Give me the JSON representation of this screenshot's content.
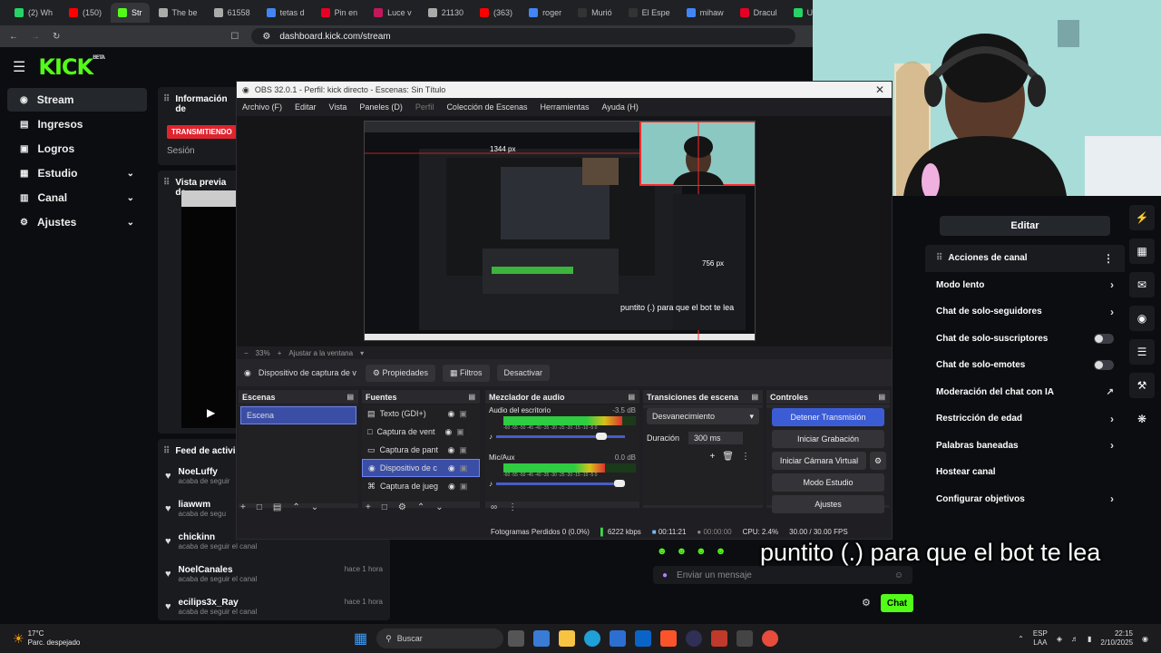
{
  "browser": {
    "tabs": [
      {
        "label": "(2) Wh",
        "color": "#25d366"
      },
      {
        "label": "(150)",
        "color": "#ff0000"
      },
      {
        "label": "Str",
        "color": "#53fc18",
        "active": true
      },
      {
        "label": "The be",
        "color": "#aaaaaa"
      },
      {
        "label": "61558",
        "color": "#aaaaaa"
      },
      {
        "label": "tetas d",
        "color": "#4285f4"
      },
      {
        "label": "Pin en",
        "color": "#e60023"
      },
      {
        "label": "Luce v",
        "color": "#c2185b"
      },
      {
        "label": "21130",
        "color": "#aaaaaa"
      },
      {
        "label": "(363)",
        "color": "#ff0000"
      },
      {
        "label": "roger",
        "color": "#4285f4"
      },
      {
        "label": "Murió",
        "color": "#333333"
      },
      {
        "label": "El Espe",
        "color": "#333333"
      },
      {
        "label": "mihaw",
        "color": "#4285f4"
      },
      {
        "label": "Dracul",
        "color": "#e60023"
      },
      {
        "label": "U",
        "color": "#25d366"
      }
    ],
    "url": "dashboard.kick.com/stream"
  },
  "kick": {
    "logo": "KICK",
    "logo_tag": "BETA",
    "nav": [
      {
        "label": "Stream",
        "icon": "broadcast-icon",
        "active": true
      },
      {
        "label": "Ingresos",
        "icon": "money-icon"
      },
      {
        "label": "Logros",
        "icon": "trophy-icon"
      },
      {
        "label": "Estudio",
        "icon": "studio-icon",
        "expandable": true
      },
      {
        "label": "Canal",
        "icon": "channel-icon",
        "expandable": true
      },
      {
        "label": "Ajustes",
        "icon": "gear-icon",
        "expandable": true
      }
    ],
    "info_title": "Información de",
    "live_badge": "TRANSMITIENDO",
    "session_label": "Sesión",
    "preview_title": "Vista previa de",
    "feed_title": "Feed de activi",
    "feed": [
      {
        "name": "NoeLuffy",
        "action": "acaba de seguir",
        "time": ""
      },
      {
        "name": "liawwm",
        "action": "acaba de segu",
        "time": ""
      },
      {
        "name": "chickinn",
        "action": "acaba de seguir el canal",
        "time": "hace 1 hora"
      },
      {
        "name": "NoelCanales",
        "action": "acaba de seguir el canal",
        "time": "hace 1 hora"
      },
      {
        "name": "ecilips3x_Ray",
        "action": "acaba de seguir el canal",
        "time": "hace 1 hora"
      }
    ]
  },
  "right_panel": {
    "edit_button": "Editar",
    "actions_title": "Acciones de canal",
    "actions": [
      {
        "label": "Modo lento",
        "control": "chevron"
      },
      {
        "label": "Chat de solo-seguidores",
        "control": "chevron"
      },
      {
        "label": "Chat de solo-suscriptores",
        "control": "toggle"
      },
      {
        "label": "Chat de solo-emotes",
        "control": "toggle"
      },
      {
        "label": "Moderación del chat con IA",
        "control": "external"
      },
      {
        "label": "Restricción de edad",
        "control": "chevron"
      },
      {
        "label": "Palabras baneadas",
        "control": "chevron"
      },
      {
        "label": "Hostear canal",
        "control": "none"
      },
      {
        "label": "Configurar objetivos",
        "control": "chevron"
      }
    ]
  },
  "chat": {
    "placeholder": "Enviar un mensaje",
    "send_button": "Chat"
  },
  "overlay_caption": "puntito (.) para que el bot te lea",
  "obs": {
    "title": "OBS 32.0.1 - Perfil: kick directo - Escenas: Sin Título",
    "menu": [
      "Archivo (F)",
      "Editar",
      "Vista",
      "Paneles (D)",
      "Perfil",
      "Colección de Escenas",
      "Herramientas",
      "Ayuda (H)"
    ],
    "preview_dims_w": "1344 px",
    "preview_dims_h": "756 px",
    "preview_caption": "puntito (.) para que el bot te lea",
    "zoom": "33%",
    "fit_label": "Ajustar a la ventana",
    "source_selected": "Dispositivo de captura de v",
    "buttons": {
      "properties": "Propiedades",
      "filters": "Filtros",
      "deactivate": "Desactivar"
    },
    "docks": {
      "scenes": {
        "title": "Escenas",
        "items": [
          "Escena"
        ]
      },
      "sources": {
        "title": "Fuentes",
        "items": [
          {
            "label": "Texto (GDI+)",
            "icon": "text-icon"
          },
          {
            "label": "Captura de vent",
            "icon": "window-icon"
          },
          {
            "label": "Captura de pant",
            "icon": "monitor-icon"
          },
          {
            "label": "Dispositivo de c",
            "icon": "camera-icon",
            "selected": true
          },
          {
            "label": "Captura de jueg",
            "icon": "gamepad-icon"
          }
        ]
      },
      "mixer": {
        "title": "Mezclador de audio",
        "channels": [
          {
            "name": "Audio del escritorio",
            "db": "-3.5 dB",
            "level": 0.9
          },
          {
            "name": "Mic/Aux",
            "db": "0.0 dB",
            "level": 0.77
          }
        ],
        "scale": "-60 -55 -50 -45 -40 -35 -30 -25 -20 -15 -10 -5 0"
      },
      "transitions": {
        "title": "Transiciones de escena",
        "type": "Desvanecimiento",
        "duration_label": "Duración",
        "duration": "300 ms"
      },
      "controls": {
        "title": "Controles",
        "buttons": [
          "Detener Transmisión",
          "Iniciar Grabación",
          "Iniciar Cámara Virtual",
          "Modo Estudio",
          "Ajustes"
        ]
      }
    },
    "status": {
      "dropped": "Fotogramas Perdidos 0 (0.0%)",
      "bitrate": "6222 kbps",
      "live_time": "00:11:21",
      "rec_time": "00:00:00",
      "cpu": "CPU: 2.4%",
      "fps": "30.00 / 30.00 FPS"
    }
  },
  "taskbar": {
    "weather_temp": "17°C",
    "weather_desc": "Parc. despejado",
    "search": "Buscar",
    "lang1": "ESP",
    "lang2": "LAA",
    "time": "22:15",
    "date": "2/10/2025"
  },
  "colors": {
    "kick_green": "#53fc18",
    "obs_blue": "#3c5cd6",
    "live_red": "#e0242f"
  }
}
